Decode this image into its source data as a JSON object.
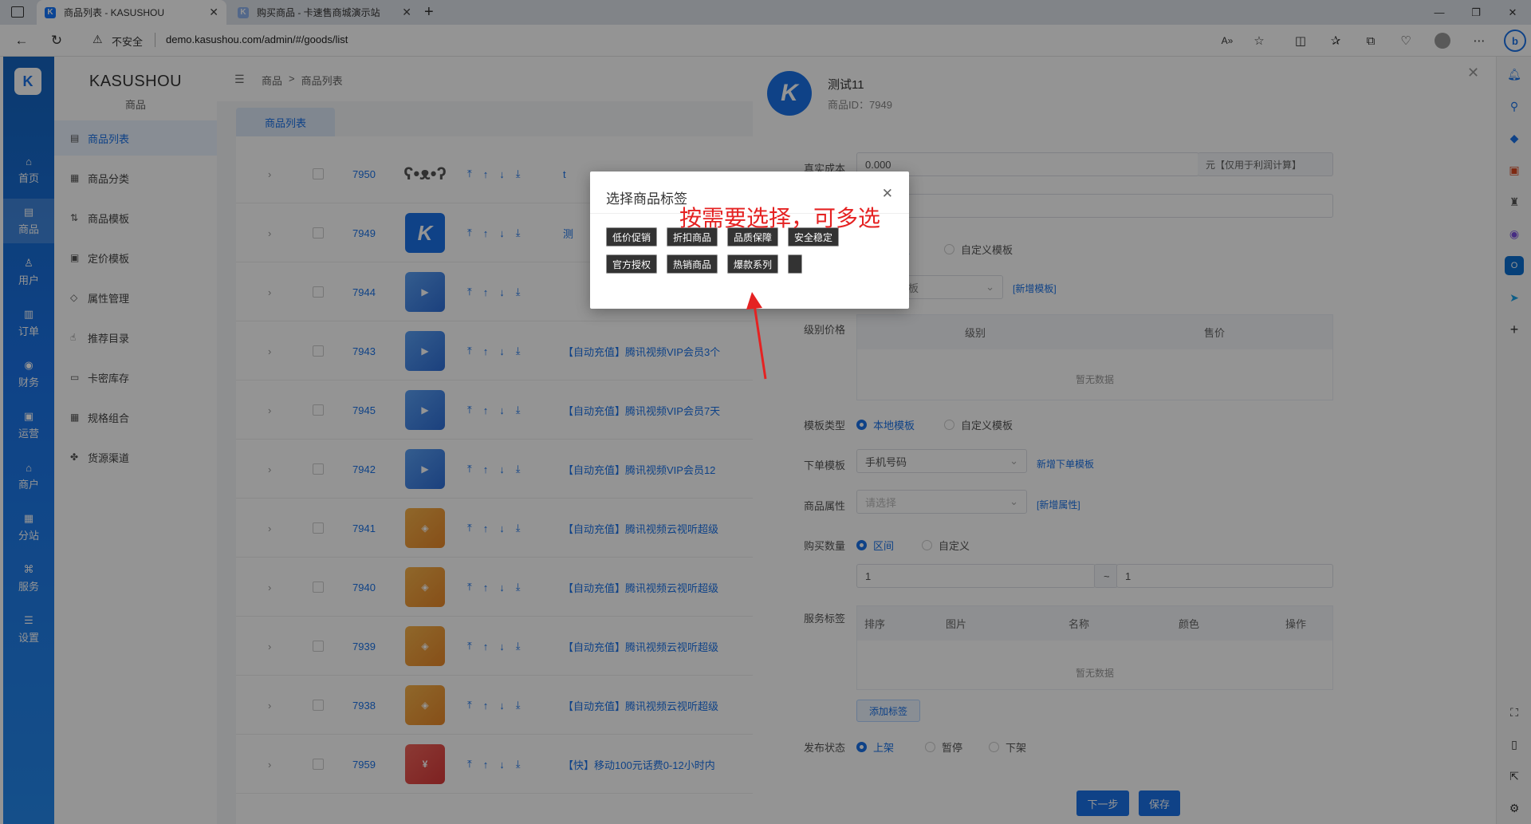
{
  "browser": {
    "tabs": [
      {
        "label": "商品列表 - KASUSHOU",
        "icon": "K",
        "active": true
      },
      {
        "label": "购买商品 - 卡速售商城演示站",
        "icon": "K",
        "active": false
      }
    ],
    "security_label": "不安全",
    "url": "demo.kasushou.com/admin/#/goods/list",
    "read_aloud": "A͡"
  },
  "app": {
    "logo": "K",
    "brand": "KASUSHOU",
    "brand_sub": "商品",
    "rail": [
      {
        "label": "首页",
        "icon": "⌂"
      },
      {
        "label": "商品",
        "icon": "▤",
        "active": true
      },
      {
        "label": "用户",
        "icon": "♙"
      },
      {
        "label": "订单",
        "icon": "▥"
      },
      {
        "label": "财务",
        "icon": "◉"
      },
      {
        "label": "运营",
        "icon": "▣"
      },
      {
        "label": "商户",
        "icon": "⌂"
      },
      {
        "label": "分站",
        "icon": "▦"
      },
      {
        "label": "服务",
        "icon": "⌘"
      },
      {
        "label": "设置",
        "icon": "☰"
      }
    ],
    "submenu": [
      {
        "label": "商品列表",
        "icon": "▤",
        "active": true
      },
      {
        "label": "商品分类",
        "icon": "▦"
      },
      {
        "label": "商品模板",
        "icon": "⇅"
      },
      {
        "label": "定价模板",
        "icon": "▣"
      },
      {
        "label": "属性管理",
        "icon": "◇"
      },
      {
        "label": "推荐目录",
        "icon": "☝"
      },
      {
        "label": "卡密库存",
        "icon": "▭"
      },
      {
        "label": "规格组合",
        "icon": "▦"
      },
      {
        "label": "货源渠道",
        "icon": "✤"
      }
    ],
    "breadcrumb": [
      "商品",
      ">",
      "商品列表"
    ],
    "page_tab": "商品列表"
  },
  "table": {
    "rows": [
      {
        "id": "7950",
        "thumb": "bear",
        "name": "t"
      },
      {
        "id": "7949",
        "thumb": "K",
        "name": "测"
      },
      {
        "id": "7944",
        "thumb": "blue",
        "name": ""
      },
      {
        "id": "7943",
        "thumb": "blue",
        "name": "【自动充值】腾讯视频VIP会员3个"
      },
      {
        "id": "7945",
        "thumb": "blue",
        "name": "【自动充值】腾讯视频VIP会员7天"
      },
      {
        "id": "7942",
        "thumb": "blue",
        "name": "【自动充值】腾讯视频VIP会员12"
      },
      {
        "id": "7941",
        "thumb": "orange",
        "name": "【自动充值】腾讯视频云视听超级"
      },
      {
        "id": "7940",
        "thumb": "orange",
        "name": "【自动充值】腾讯视频云视听超级"
      },
      {
        "id": "7939",
        "thumb": "orange",
        "name": "【自动充值】腾讯视频云视听超级"
      },
      {
        "id": "7938",
        "thumb": "orange",
        "name": "【自动充值】腾讯视频云视听超级"
      },
      {
        "id": "7959",
        "thumb": "red",
        "name": "【快】移动100元话费0-12小时内"
      }
    ]
  },
  "drawer": {
    "title": "测试11",
    "product_id": "商品ID：7949",
    "cost_label": "真实成本",
    "cost_value": "0.000",
    "cost_suffix": "元【仅用于利润计算】",
    "template_a_partial": "板",
    "custom_template": "自定义模板",
    "select_partial": "板",
    "new_template_link": "[新增模板]",
    "level_price_label": "级别价格",
    "grid_cols": [
      "级别",
      "售价"
    ],
    "no_data": "暂无数据",
    "template_type_label": "模板类型",
    "local_template": "本地模板",
    "order_template_label": "下单模板",
    "order_template_value": "手机号码",
    "new_order_template_link": "新增下单模板",
    "attr_label": "商品属性",
    "attr_placeholder": "请选择",
    "new_attr_link": "[新增属性]",
    "qty_label": "购买数量",
    "qty_range": "区间",
    "qty_custom": "自定义",
    "qty_min": "1",
    "qty_sep": "~",
    "qty_max": "1",
    "service_label": "服务标签",
    "service_cols": [
      "排序",
      "图片",
      "名称",
      "颜色",
      "操作"
    ],
    "add_tag": "添加标签",
    "publish_label": "发布状态",
    "publish_options": [
      "上架",
      "暂停",
      "下架"
    ],
    "btn_next": "下一步",
    "btn_save": "保存"
  },
  "dialog": {
    "title": "选择商品标签",
    "tags": [
      "低价促销",
      "折扣商品",
      "品质保障",
      "安全稳定",
      "官方授权",
      "热销商品",
      "爆款系列",
      ""
    ],
    "annotation": "按需要选择，可多选"
  },
  "colors": {
    "accent": "#1a73e8",
    "annotation": "#e52222"
  }
}
